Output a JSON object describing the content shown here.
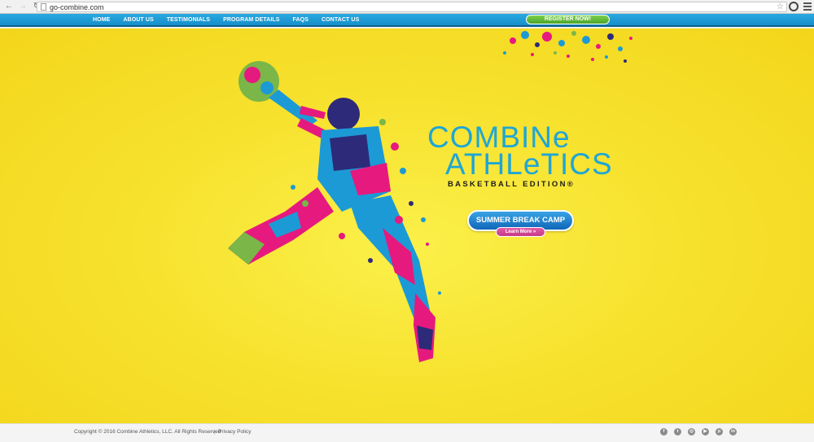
{
  "browser": {
    "url": "go-combine.com"
  },
  "nav": {
    "items": [
      "HOME",
      "ABOUT US",
      "TESTIMONIALS",
      "PROGRAM DETAILS",
      "FAQS",
      "CONTACT US"
    ],
    "register_label": "REGISTER NOW!"
  },
  "hero": {
    "brand_line1": "COMBINe",
    "brand_line2": "ATHLeTICS",
    "brand_subtitle": "BASKETBALL EDITION®",
    "camp_button": "SUMMER BREAK CAMP",
    "learn_more": "Learn More »"
  },
  "footer": {
    "copyright": "Copyright © 2016 Combine Athletics, LLC. All Rights Reserved",
    "separator": "|",
    "privacy": "Privacy Policy",
    "socials": [
      {
        "icon": "facebook-icon",
        "glyph": "f"
      },
      {
        "icon": "twitter-icon",
        "glyph": "t"
      },
      {
        "icon": "instagram-icon",
        "glyph": "◎"
      },
      {
        "icon": "youtube-icon",
        "glyph": "▶"
      },
      {
        "icon": "pinterest-icon",
        "glyph": "p"
      },
      {
        "icon": "linkedin-icon",
        "glyph": "in"
      }
    ]
  },
  "colors": {
    "hero_yellow": "#f7e22f",
    "nav_blue": "#1e9bd6",
    "brand_blue": "#1ea6d6",
    "register_green": "#5cb833",
    "learn_pink": "#d94a98"
  }
}
